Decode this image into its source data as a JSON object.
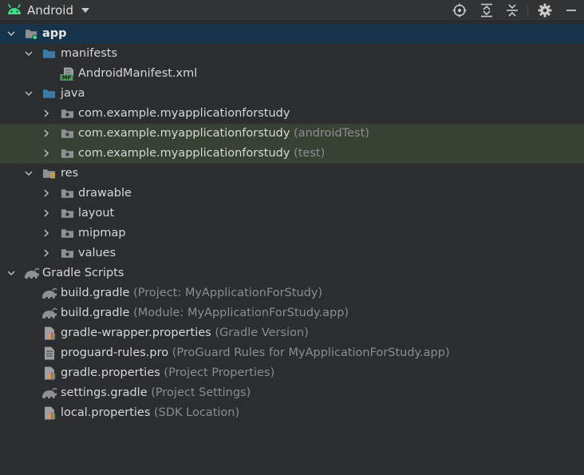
{
  "toolbar": {
    "view_label": "Android",
    "icons": [
      "locate-icon",
      "expand-all-icon",
      "collapse-all-icon",
      "settings-icon",
      "minimize-icon"
    ]
  },
  "tree": {
    "app": "app",
    "manifests": "manifests",
    "manifest_file": "AndroidManifest.xml",
    "manifest_badge": "MF",
    "java": "java",
    "pkg_main": "com.example.myapplicationforstudy",
    "pkg_android_test": "com.example.myapplicationforstudy",
    "pkg_android_test_hint": "(androidTest)",
    "pkg_test": "com.example.myapplicationforstudy",
    "pkg_test_hint": "(test)",
    "res": "res",
    "drawable": "drawable",
    "layout": "layout",
    "mipmap": "mipmap",
    "values": "values",
    "gradle_scripts": "Gradle Scripts",
    "gradle_files": [
      {
        "name": "build.gradle",
        "hint": "(Project: MyApplicationForStudy)"
      },
      {
        "name": "build.gradle",
        "hint": "(Module: MyApplicationForStudy.app)"
      },
      {
        "name": "gradle-wrapper.properties",
        "hint": "(Gradle Version)"
      },
      {
        "name": "proguard-rules.pro",
        "hint": "(ProGuard Rules for MyApplicationForStudy.app)"
      },
      {
        "name": "gradle.properties",
        "hint": "(Project Properties)"
      },
      {
        "name": "settings.gradle",
        "hint": "(Project Settings)"
      },
      {
        "name": "local.properties",
        "hint": "(SDK Location)"
      }
    ]
  },
  "colors": {
    "background": "#2b2d30",
    "selected_row": "#17344a",
    "test_row": "#394134",
    "android_green": "#3ddc84",
    "folder_blue": "#3d7ba6",
    "hint_text": "#8b8e91"
  }
}
